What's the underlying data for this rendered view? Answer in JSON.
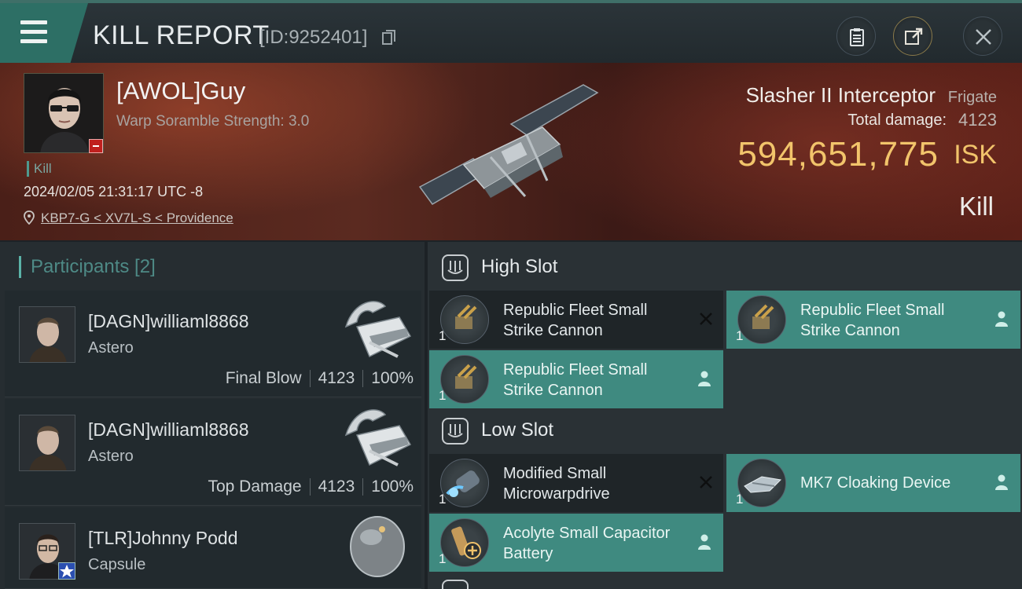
{
  "header": {
    "title": "KILL REPORT",
    "report_id": "[ID:9252401]"
  },
  "victim": {
    "name": "[AWOL]Guy",
    "warp_scramble": "Warp Soramble Strength: 3.0",
    "tag": "Kill",
    "datetime": "2024/02/05 21:31:17 UTC -8",
    "location": "KBP7-G < XV7L-S < Providence"
  },
  "ship": {
    "name": "Slasher II Interceptor",
    "class": "Frigate",
    "total_damage_label": "Total damage:",
    "total_damage": "4123",
    "isk_value": "594,651,775",
    "isk_unit": "ISK",
    "result": "Kill"
  },
  "participants": {
    "header": "Participants [2]",
    "rows": [
      {
        "name": "[DAGN]williaml8868",
        "ship": "Astero",
        "role": "Final Blow",
        "damage": "4123",
        "percent": "100%"
      },
      {
        "name": "[DAGN]williaml8868",
        "ship": "Astero",
        "role": "Top Damage",
        "damage": "4123",
        "percent": "100%"
      },
      {
        "name": "[TLR]Johnny Podd",
        "ship": "Capsule"
      }
    ]
  },
  "slots": {
    "high_label": "High Slot",
    "low_label": "Low Slot",
    "high": [
      {
        "name": "Republic Fleet Small Strike Cannon",
        "qty": "1",
        "state": "destroyed"
      },
      {
        "name": "Republic Fleet Small Strike Cannon",
        "qty": "1",
        "state": "dropped"
      },
      {
        "name": "Republic Fleet Small Strike Cannon",
        "qty": "1",
        "state": "dropped"
      }
    ],
    "low": [
      {
        "name": "Modified Small Microwarpdrive",
        "qty": "1",
        "state": "destroyed"
      },
      {
        "name": "MK7 Cloaking Device",
        "qty": "1",
        "state": "dropped"
      },
      {
        "name": "Acolyte Small Capacitor Battery",
        "qty": "1",
        "state": "dropped"
      }
    ]
  },
  "colors": {
    "accent_teal": "#3f8a80",
    "isk_gold": "#f2c46b",
    "banner_red": "#5b2a20"
  },
  "icons": {
    "menu": "hamburger-icon",
    "copy": "copy-icon",
    "clipboard": "clipboard-icon",
    "share": "share-icon",
    "close": "close-icon",
    "location": "location-pin-icon",
    "slot": "slot-icon",
    "destroyed": "x-icon",
    "dropped": "person-icon"
  }
}
